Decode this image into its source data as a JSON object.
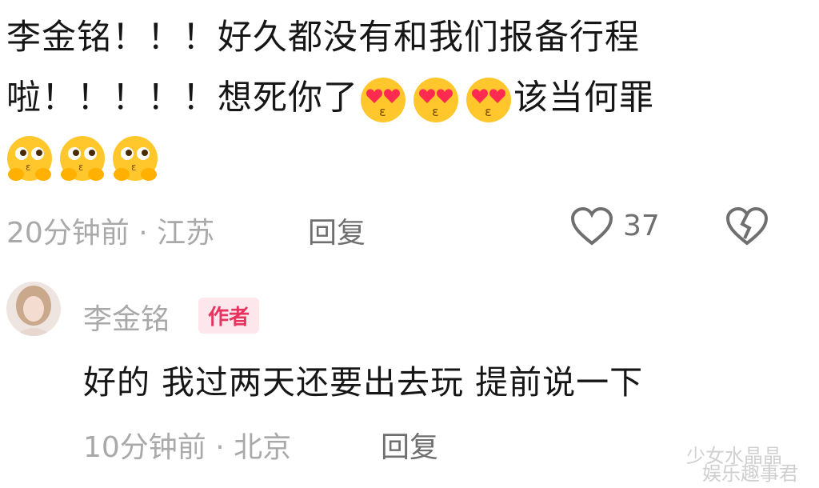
{
  "main_comment": {
    "line1": "李金铭！！！好久都没有和我们报备行程",
    "line2_text": "啦！！！！！想死你了",
    "line2_tail": "该当何罪",
    "emoji_heart_eyes_icon": "heart-eyes-kiss-emoji",
    "emoji_pleading_icon": "pleading-hands-emoji",
    "time": "20分钟前",
    "separator": "·",
    "location": "江苏",
    "reply_label": "回复",
    "like_count": "37"
  },
  "reply": {
    "author": "李金铭",
    "badge": "作者",
    "text": "好的 我过两天还要出去玩 提前说一下",
    "time": "10分钟前",
    "separator": "·",
    "location": "北京",
    "reply_label": "回复"
  },
  "watermark": {
    "line1": "少女水晶晶",
    "line2": "娱乐趣事君"
  },
  "colors": {
    "badge_bg": "#fde6ec",
    "badge_text": "#e8335f",
    "meta_gray": "#a9a9a9",
    "emoji_yellow": "#ffc72c"
  }
}
